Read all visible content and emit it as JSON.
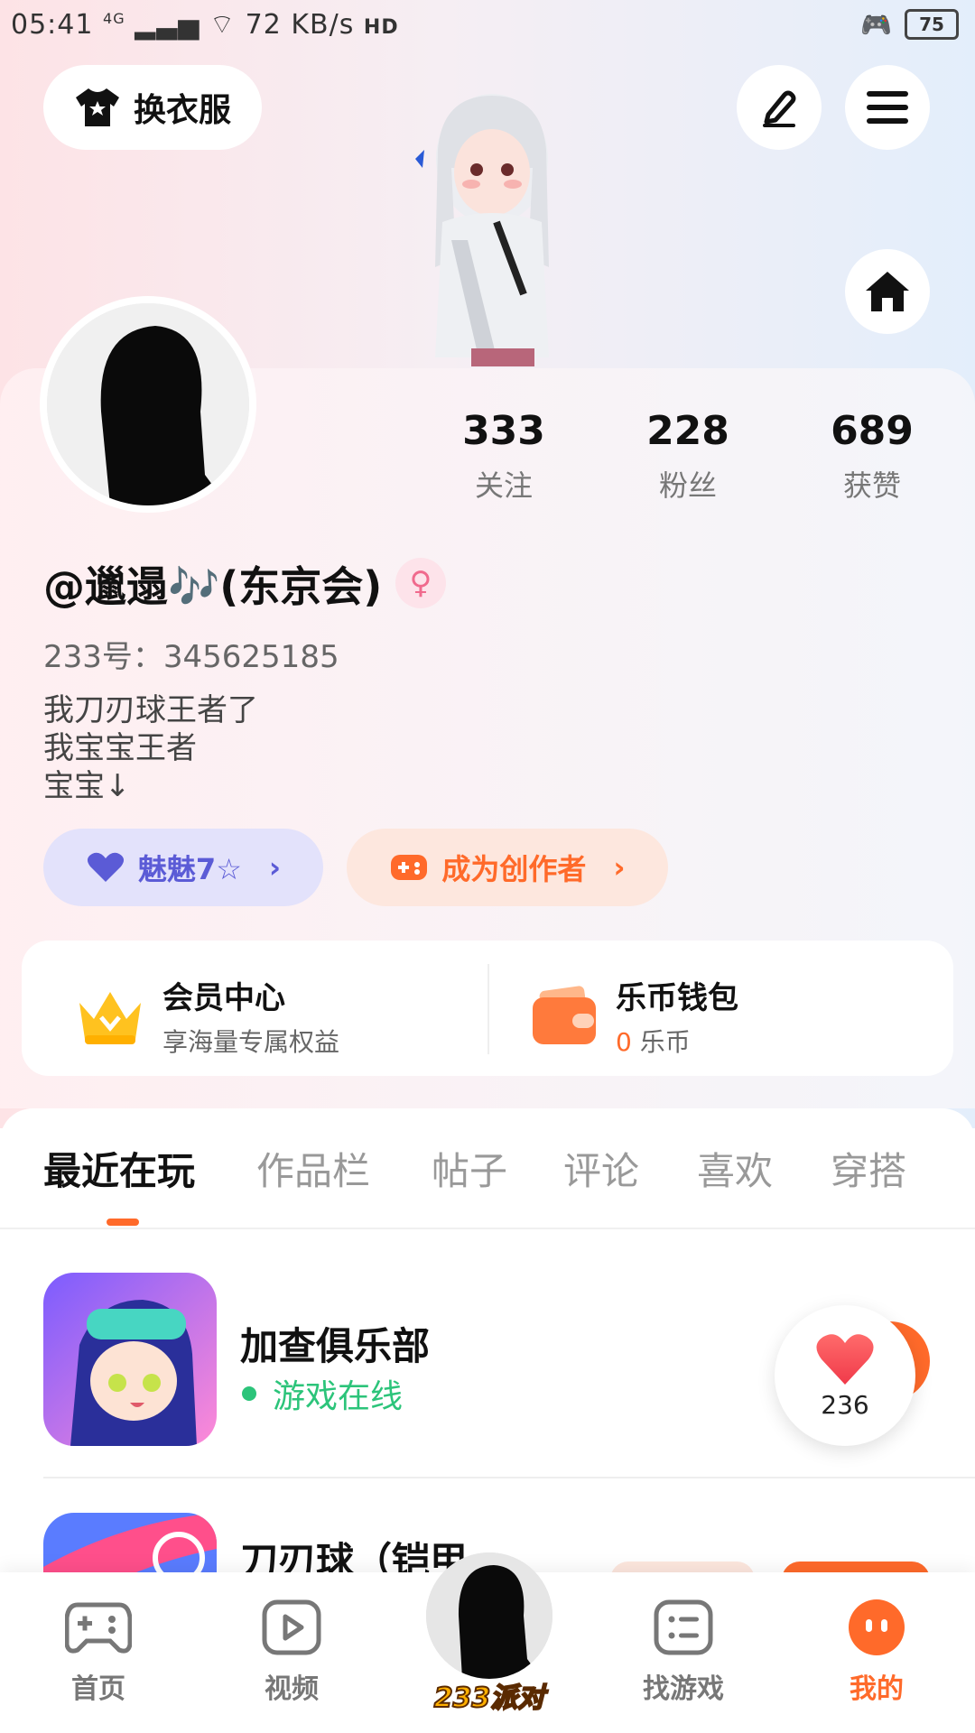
{
  "status_bar": {
    "time": "05:41",
    "network": "4G",
    "speed": "72 KB/s",
    "hd": "HD",
    "battery": "75"
  },
  "top": {
    "outfit_label": "换衣服"
  },
  "profile": {
    "stats": [
      {
        "value": "333",
        "label": "关注"
      },
      {
        "value": "228",
        "label": "粉丝"
      },
      {
        "value": "689",
        "label": "获赞"
      }
    ],
    "username": "@邋遢🎶(东京会)",
    "gender_symbol": "♀",
    "id_line": "233号：345625185",
    "bio_lines": [
      "我刀刃球王者了",
      "我宝宝王者",
      "宝宝↓"
    ],
    "charm_label": "魅魅7☆",
    "creator_label": "成为创作者"
  },
  "member": {
    "vip_title": "会员中心",
    "vip_sub": "享海量专属权益",
    "wallet_title": "乐币钱包",
    "wallet_amount": "0",
    "wallet_unit": "乐币"
  },
  "tabs": [
    "最近在玩",
    "作品栏",
    "帖子",
    "评论",
    "喜欢",
    "穿搭"
  ],
  "games": [
    {
      "title": "加查俱乐部",
      "status": "游戏在线"
    },
    {
      "title": "刀刃球（铠甲"
    }
  ],
  "like_count": "236",
  "bottom_nav": {
    "home": "首页",
    "video": "视频",
    "party": "233派对",
    "find": "找游戏",
    "mine": "我的"
  },
  "colors": {
    "accent": "#ff6a2a",
    "online": "#2cc47a",
    "charm": "#5b5bd6"
  }
}
